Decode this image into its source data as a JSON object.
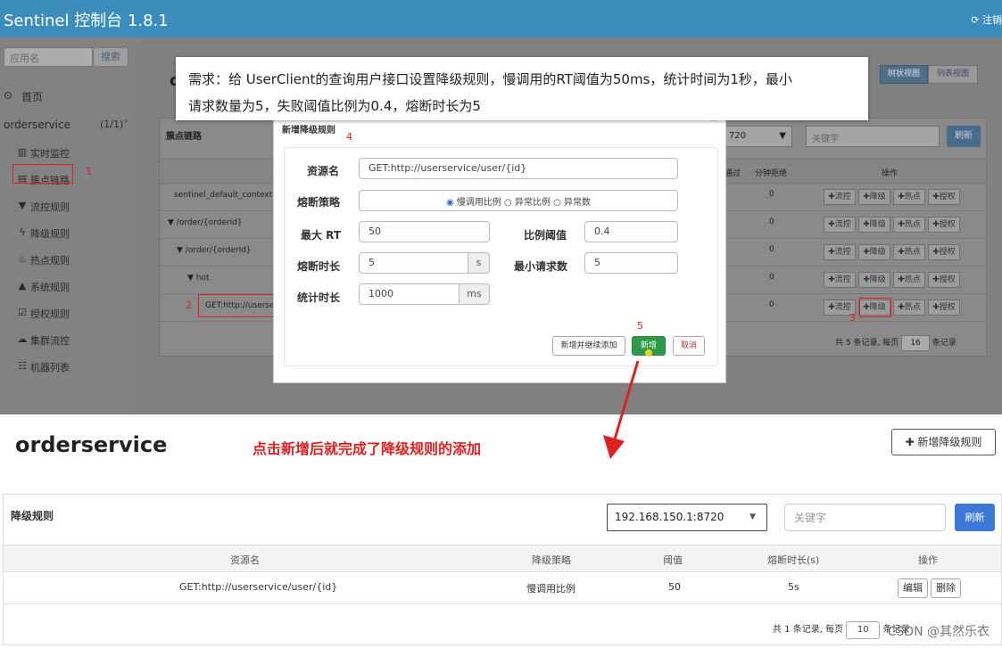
{
  "app": {
    "title": "Sentinel 控制台 1.8.1",
    "logout": "注销"
  },
  "sidebar": {
    "search_placeholder": "应用名",
    "search_btn": "搜索",
    "home": "首页",
    "app_name": "orderservice",
    "app_count": "(1/1)",
    "items": [
      {
        "label": "实时监控",
        "icon": "chart-icon"
      },
      {
        "label": "簇点链路",
        "icon": "list-icon"
      },
      {
        "label": "流控规则",
        "icon": "filter-icon"
      },
      {
        "label": "降级规则",
        "icon": "bolt-icon"
      },
      {
        "label": "热点规则",
        "icon": "fire-icon"
      },
      {
        "label": "系统规则",
        "icon": "lock-icon"
      },
      {
        "label": "授权规则",
        "icon": "check-icon"
      },
      {
        "label": "集群流控",
        "icon": "cloud-icon"
      },
      {
        "label": "机器列表",
        "icon": "grid-icon"
      }
    ]
  },
  "view_toggle": {
    "tree": "树状视图",
    "list": "列表视图"
  },
  "callout": {
    "line1": "需求：给 UserClient的查询用户接口设置降级规则，慢调用的RT阈值为50ms，统计时间为1秒，最小",
    "line2": "请求数量为5，失败阈值比例为0.4，熔断时长为5"
  },
  "cluster_panel": {
    "title": "簇点链路",
    "ip_partial": "720",
    "keyword_placeholder": "关键字",
    "refresh": "刷新",
    "col_pass": "通过",
    "col_reject": "分钟拒绝",
    "col_ops": "操作",
    "rows": [
      {
        "name": "sentinel_default_context",
        "reject": "0"
      },
      {
        "name": "▼ /order/{orderId}",
        "reject": "0"
      },
      {
        "name": "▼ /order/{orderId}",
        "reject": "0"
      },
      {
        "name": "▼ hot",
        "reject": "0"
      },
      {
        "name": "GET:http://userser",
        "reject": "0"
      }
    ],
    "ops": [
      "✚流控",
      "✚降级",
      "✚热点",
      "✚授权"
    ],
    "pagination": {
      "prefix": "共 5 条记录, 每页",
      "page_size": "16",
      "suffix": "条记录"
    }
  },
  "modal": {
    "title": "新增降级规则",
    "resource_label": "资源名",
    "resource_value": "GET:http://userservice/user/{id}",
    "strategy_label": "熔断策略",
    "strategy_options": [
      "慢调用比例",
      "异常比例",
      "异常数"
    ],
    "max_rt_label": "最大 RT",
    "max_rt_value": "50",
    "ratio_label": "比例阈值",
    "ratio_value": "0.4",
    "break_label": "熔断时长",
    "break_value": "5",
    "break_unit": "s",
    "min_req_label": "最小请求数",
    "min_req_value": "5",
    "stat_label": "统计时长",
    "stat_value": "1000",
    "stat_unit": "ms",
    "btn_add_continue": "新增并继续添加",
    "btn_add": "新增",
    "btn_cancel": "取消"
  },
  "markers": [
    "1",
    "2",
    "3",
    "4",
    "5"
  ],
  "lower": {
    "title": "orderservice",
    "annotation": "点击新增后就完成了降级规则的添加",
    "add_rule_btn": "✚ 新增降级规则",
    "panel_title": "降级规则",
    "ip_select": "192.168.150.1:8720",
    "keyword_placeholder": "关键字",
    "refresh": "刷新",
    "headers": [
      "资源名",
      "降级策略",
      "阈值",
      "熔断时长(s)",
      "操作"
    ],
    "row": {
      "resource": "GET:http://userservice/user/{id}",
      "strategy": "慢调用比例",
      "threshold": "50",
      "duration": "5s"
    },
    "edit": "编辑",
    "delete": "删除",
    "pagination": {
      "prefix": "共 1 条记录, 每页",
      "page_size": "10",
      "suffix": "条记录"
    }
  },
  "watermark": "CSDN @其然乐衣"
}
